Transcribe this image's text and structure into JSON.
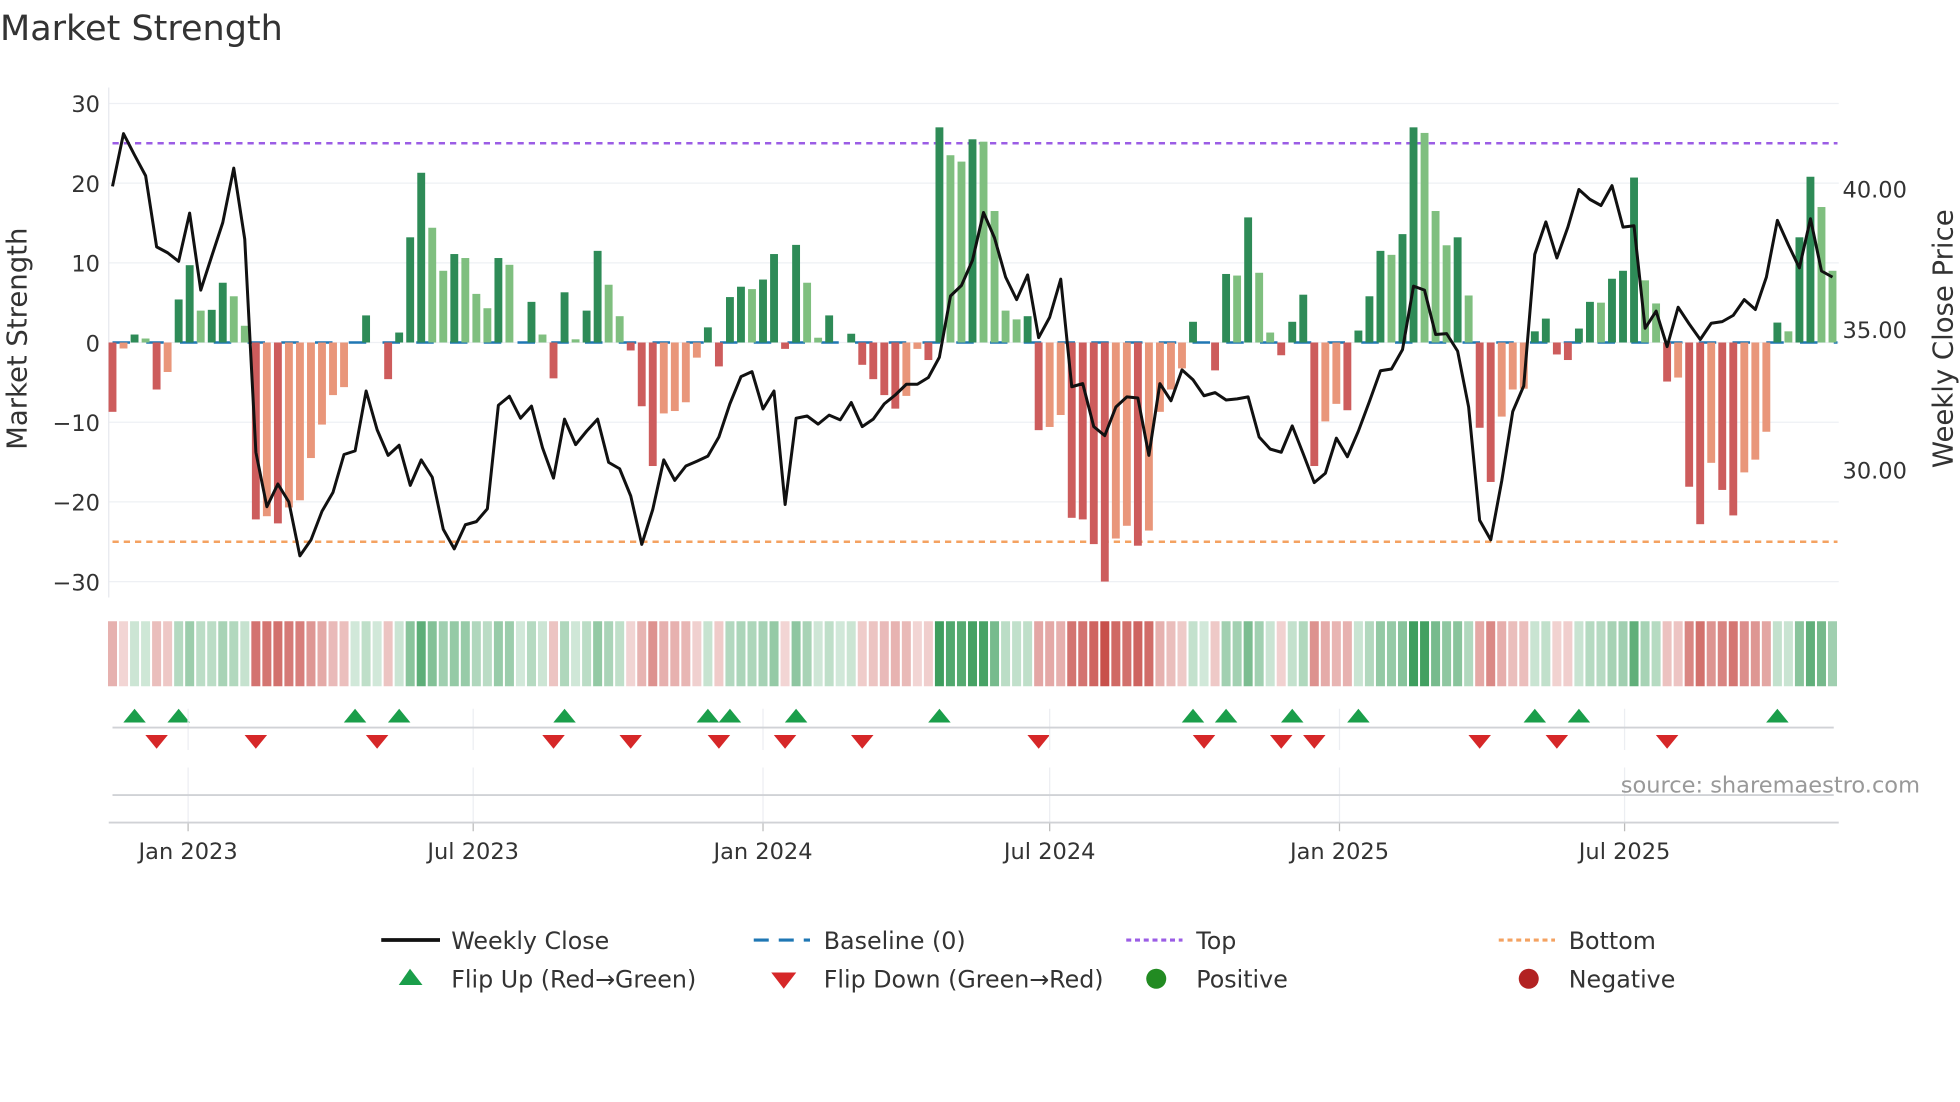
{
  "title": "Market Strength",
  "source": "source: sharemaestro.com",
  "colors": {
    "rising_positive": "#2e8b57",
    "falling_positive": "#7fbf7f",
    "falling_negative": "#cd5c5c",
    "rising_negative": "#e9967a",
    "line": "#111111",
    "baseline": "#1f77b4",
    "top": "#9b5de5",
    "bottom": "#f4a261",
    "flip_up": "#1a9e4a",
    "flip_down": "#d62728",
    "positive": "#228b22",
    "negative": "#b22222"
  },
  "legend": [
    {
      "label": "Weekly Close",
      "icon": "line-swatch"
    },
    {
      "label": "Baseline (0)",
      "icon": "dashed-line-swatch"
    },
    {
      "label": "Top",
      "icon": "dotted-line-swatch"
    },
    {
      "label": "Bottom",
      "icon": "dotted-line-swatch"
    },
    {
      "label": "Flip Up (Red→Green)",
      "icon": "triangle-up-icon"
    },
    {
      "label": "Flip Down (Green→Red)",
      "icon": "triangle-down-icon"
    },
    {
      "label": "Positive",
      "icon": "circle-icon"
    },
    {
      "label": "Negative",
      "icon": "circle-icon"
    }
  ],
  "chart_data": {
    "type": "bar",
    "title": "Market Strength",
    "ylabel": "Market Strength",
    "y2label": "Weekly Close Price",
    "ylim": [
      -32,
      32
    ],
    "y2lim": [
      25.45,
      43.6
    ],
    "yticks": [
      "30",
      "20",
      "10",
      "0",
      "−10",
      "−20",
      "−30"
    ],
    "ytick_values": [
      30,
      20,
      10,
      0,
      -10,
      -20,
      -30
    ],
    "y2ticks": [
      "40.00",
      "35.00",
      "30.00"
    ],
    "y2tick_values": [
      40,
      35,
      30
    ],
    "x_start_date": "2022-11-14",
    "x_interval": "weekly",
    "x_ticks": [
      {
        "label": "Jan 2023",
        "date": "2023-01-01"
      },
      {
        "label": "Jul 2023",
        "date": "2023-07-01"
      },
      {
        "label": "Jan 2024",
        "date": "2024-01-01"
      },
      {
        "label": "Jul 2024",
        "date": "2024-07-01"
      },
      {
        "label": "Jan 2025",
        "date": "2025-01-01"
      },
      {
        "label": "Jul 2025",
        "date": "2025-07-01"
      }
    ],
    "top_level": 25,
    "bottom_level": -25,
    "baseline": 0,
    "grid": true,
    "legend_position": "bottom",
    "series": [
      {
        "name": "Market Strength",
        "type": "bar",
        "values": [
          -8.7,
          -0.75,
          1,
          0.5,
          -5.9,
          -3.7,
          5.4,
          9.7,
          4,
          4.1,
          7.5,
          5.8,
          2.1,
          -22.2,
          -21.8,
          -22.7,
          -20.7,
          -19.8,
          -14.5,
          -10.3,
          -6.6,
          -5.6,
          0,
          3.4,
          0,
          -4.6,
          1.25,
          13.2,
          21.3,
          14.4,
          9,
          11.1,
          10.6,
          6.1,
          4.3,
          10.6,
          9.75,
          0,
          5.1,
          1,
          -4.5,
          6.3,
          0.4,
          4,
          11.5,
          7.25,
          3.3,
          -1,
          -8,
          -15.5,
          -8.9,
          -8.6,
          -7.5,
          -1.9,
          1.9,
          -3,
          5.7,
          7,
          6.7,
          7.9,
          11.1,
          -0.8,
          12.25,
          7.5,
          0.6,
          3.4,
          0,
          1.1,
          -2.8,
          -4.6,
          -6.6,
          -8.3,
          -6.7,
          -0.8,
          -2.2,
          27,
          23.5,
          22.7,
          25.5,
          25.2,
          16.5,
          4,
          2.9,
          3.3,
          -11,
          -10.6,
          -9.1,
          -22,
          -22.2,
          -25.3,
          -30,
          -24.6,
          -23,
          -25.5,
          -23.6,
          -8.7,
          -5.9,
          -3.25,
          2.6,
          0,
          -3.5,
          8.6,
          8.4,
          15.7,
          8.75,
          1.25,
          -1.6,
          2.6,
          6,
          -15.5,
          -9.9,
          -7.7,
          -8.5,
          1.5,
          5.8,
          11.5,
          11,
          13.6,
          27,
          26.3,
          16.5,
          12.2,
          13.2,
          5.9,
          -10.7,
          -17.5,
          -9.3,
          -5.9,
          -5.8,
          1.4,
          3,
          -1.5,
          -2.2,
          1.75,
          5.1,
          5,
          8,
          9,
          20.7,
          7.8,
          4.9,
          -4.9,
          -4.4,
          -18.1,
          -22.8,
          -15.1,
          -18.5,
          -21.7,
          -16.3,
          -14.7,
          -11.2,
          2.5,
          1.4,
          13.2,
          20.8,
          17,
          9
        ]
      },
      {
        "name": "Weekly Close",
        "type": "line",
        "axis": "right",
        "values": [
          40.08,
          41.96,
          41.2,
          40.46,
          37.93,
          37.72,
          37.41,
          39.13,
          36.39,
          37.6,
          38.79,
          40.73,
          38.2,
          30.62,
          28.68,
          29.49,
          28.85,
          26.93,
          27.5,
          28.52,
          29.19,
          30.54,
          30.67,
          32.8,
          31.42,
          30.51,
          30.87,
          29.44,
          30.35,
          29.73,
          27.88,
          27.18,
          28.04,
          28.15,
          28.61,
          32.29,
          32.61,
          31.83,
          32.26,
          30.78,
          29.7,
          31.8,
          30.89,
          31.37,
          31.8,
          30.26,
          30.03,
          29.06,
          27.34,
          28.58,
          30.35,
          29.62,
          30.13,
          30.3,
          30.48,
          31.16,
          32.34,
          33.31,
          33.49,
          32.16,
          32.8,
          28.76,
          31.83,
          31.91,
          31.62,
          31.94,
          31.77,
          32.39,
          31.53,
          31.8,
          32.34,
          32.66,
          33.04,
          33.04,
          33.28,
          34,
          36.18,
          36.56,
          37.45,
          39.15,
          38.25,
          36.85,
          36.05,
          36.93,
          34.7,
          35.42,
          36.78,
          32.95,
          33.06,
          31.53,
          31.21,
          32.23,
          32.59,
          32.55,
          30.51,
          33.06,
          32.45,
          33.55,
          33.2,
          32.63,
          32.74,
          32.48,
          32.52,
          32.59,
          31.16,
          30.73,
          30.62,
          31.56,
          30.56,
          29.54,
          29.87,
          31.12,
          30.46,
          31.37,
          32.42,
          33.52,
          33.58,
          34.27,
          36.53,
          36.39,
          34.81,
          34.84,
          34.22,
          32.23,
          28.2,
          27.5,
          29.6,
          32.07,
          32.98,
          37.66,
          38.82,
          37.53,
          38.63,
          39.97,
          39.62,
          39.4,
          40.11,
          38.63,
          38.68,
          35.03,
          35.64,
          34.38,
          35.78,
          35.19,
          34.63,
          35.21,
          35.27,
          35.49,
          36.05,
          35.7,
          36.85,
          38.87,
          38.0,
          37.18,
          38.93,
          37.07,
          36.85
        ]
      }
    ],
    "flip_up_weeks": [
      2,
      6,
      22,
      26,
      41,
      54,
      56,
      62,
      75,
      98,
      101,
      107,
      113,
      129,
      133,
      151
    ],
    "flip_down_weeks": [
      4,
      13,
      24,
      40,
      47,
      55,
      61,
      68,
      84,
      99,
      106,
      109,
      124,
      131,
      141
    ]
  }
}
